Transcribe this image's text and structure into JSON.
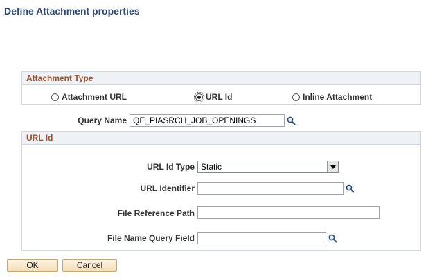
{
  "page": {
    "title": "Define Attachment properties"
  },
  "attachment_type": {
    "header": "Attachment Type",
    "options": [
      {
        "label": "Attachment URL",
        "selected": false
      },
      {
        "label": "URL Id",
        "selected": true
      },
      {
        "label": "Inline Attachment",
        "selected": false
      }
    ]
  },
  "query": {
    "label": "Query Name",
    "value": "QE_PIASRCH_JOB_OPENINGS"
  },
  "url_id": {
    "header": "URL Id",
    "type_label": "URL Id Type",
    "type_value": "Static",
    "identifier_label": "URL Identifier",
    "identifier_value": "",
    "file_ref_label": "File Reference Path",
    "file_ref_value": "",
    "file_name_label": "File Name Query Field",
    "file_name_value": ""
  },
  "buttons": {
    "ok": "OK",
    "cancel": "Cancel"
  },
  "icons": {
    "lookup": "magnifier-icon",
    "dropdown": "dropdown-arrow-icon"
  },
  "colors": {
    "title": "#2b4a79",
    "group_header_text": "#a0502a",
    "group_header_bg": "#eef1f5"
  }
}
